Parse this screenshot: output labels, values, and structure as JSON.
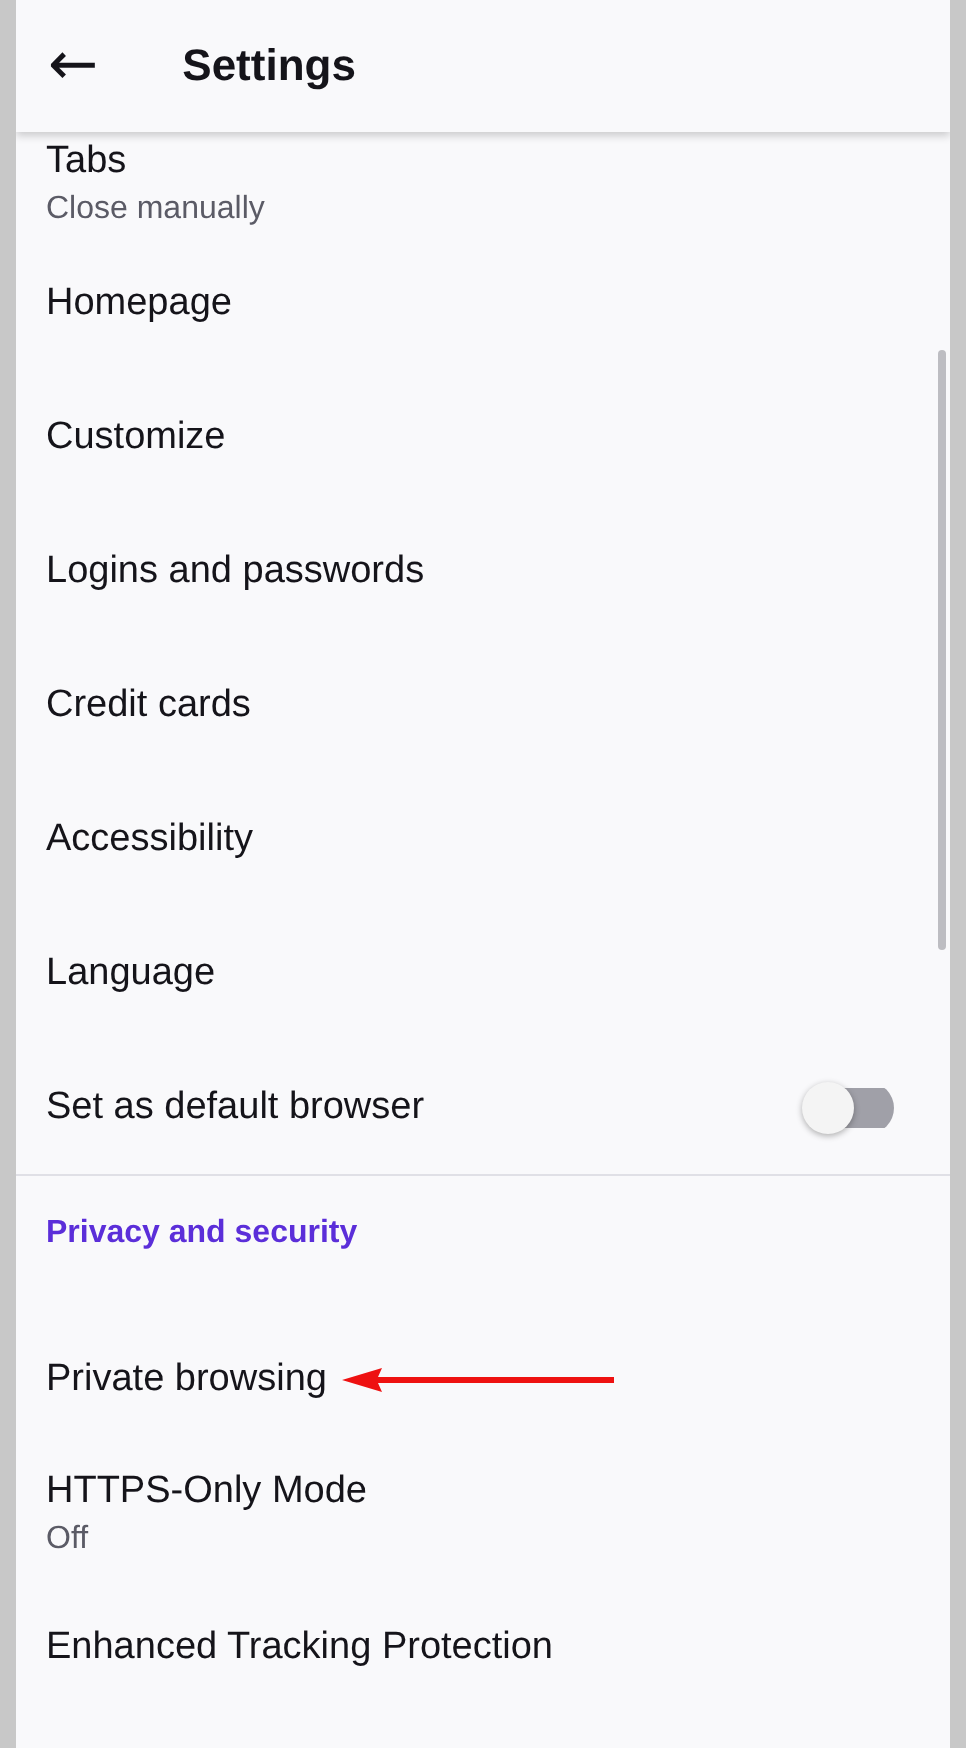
{
  "app_bar": {
    "back": "←",
    "title": "Settings"
  },
  "items": [
    {
      "kind": "item",
      "label": "Tabs",
      "summary": "Close manually"
    },
    {
      "kind": "item",
      "label": "Homepage"
    },
    {
      "kind": "item",
      "label": "Customize"
    },
    {
      "kind": "item",
      "label": "Logins and passwords"
    },
    {
      "kind": "item",
      "label": "Credit cards"
    },
    {
      "kind": "item",
      "label": "Accessibility"
    },
    {
      "kind": "item",
      "label": "Language"
    },
    {
      "kind": "toggle",
      "label": "Set as default browser",
      "on": false
    },
    {
      "kind": "header",
      "label": "Privacy and security"
    },
    {
      "kind": "item",
      "label": "Private browsing",
      "annotated": true
    },
    {
      "kind": "item",
      "label": "HTTPS-Only Mode",
      "summary": "Off"
    },
    {
      "kind": "item",
      "label": "Enhanced Tracking Protection"
    }
  ]
}
